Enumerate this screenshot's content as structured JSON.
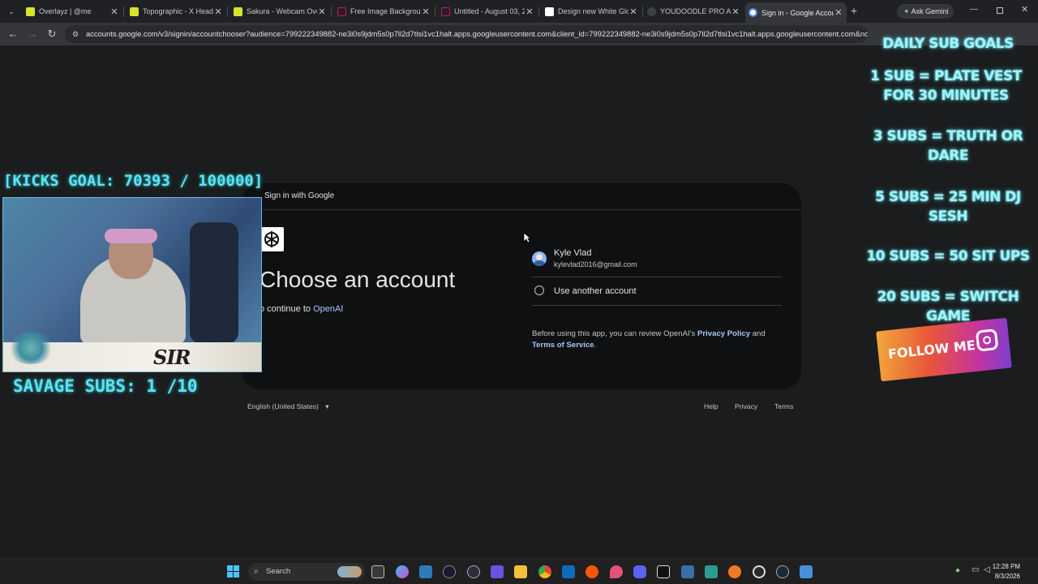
{
  "browser": {
    "tabs": [
      {
        "title": "Overlayz | @me",
        "color": "#d7e52a"
      },
      {
        "title": "Topographic - X Head",
        "color": "#d7e52a"
      },
      {
        "title": "Sakura - Webcam Ove",
        "color": "#d7e52a"
      },
      {
        "title": "Free Image Backgroun",
        "color": "#c2185b"
      },
      {
        "title": "Untitled - August 03, 2",
        "color": "#c2185b"
      },
      {
        "title": "Design new White Glo",
        "color": "#ffffff"
      },
      {
        "title": "YOUDOODLE PRO APK",
        "color": "#4285f4"
      },
      {
        "title": "Sign in - Google Accou",
        "color": "#4285f4",
        "active": true
      }
    ],
    "new_tab": "+",
    "ask_gemini": "Ask Gemini",
    "url": "accounts.google.com/v3/signin/accountchooser?audience=799222349882-ne3i0s9jdm5s0p7ll2d7tlsi1vc1halt.apps.googleusercontent.com&client_id=799222349882-ne3i0s9jdm5s0p7ll2d7tlsi1vc1halt.apps.googleusercontent.com&nor"
  },
  "google": {
    "header": "Sign in with Google",
    "title": "Choose an account",
    "continue_prefix": "o continue to",
    "continue_app": "OpenAI",
    "account": {
      "name": "Kyle Vlad",
      "email": "kylevlad2016@gmail.com"
    },
    "other": "Use another account",
    "policy_prefix": "Before using this app, you can review OpenAI's",
    "privacy_policy": "Privacy Policy",
    "and": "and",
    "terms_of_service": "Terms of Service",
    "period": ".",
    "language": "English (United States)",
    "footer": {
      "help": "Help",
      "privacy": "Privacy",
      "terms": "Terms"
    }
  },
  "overlay": {
    "kicks_goal": "[KICKS GOAL: 70393 / 100000]",
    "savage_subs": "SAVAGE SUBS: 1  /10",
    "webcam_tag": "SIR SAVAGE",
    "goals": [
      "DAILY SUB GOALS",
      "1 SUB = PLATE VEST FOR 30 MINUTES",
      "3 SUBS = TRUTH OR DARE",
      "5 SUBS = 25 MIN DJ SESH",
      "10 SUBS = 50 SIT UPS",
      "20 SUBS = SWITCH GAME"
    ],
    "follow": "FOLLOW ME"
  },
  "taskbar": {
    "search": "Search",
    "time": "12:28 PM",
    "date": "8/3/2026"
  }
}
